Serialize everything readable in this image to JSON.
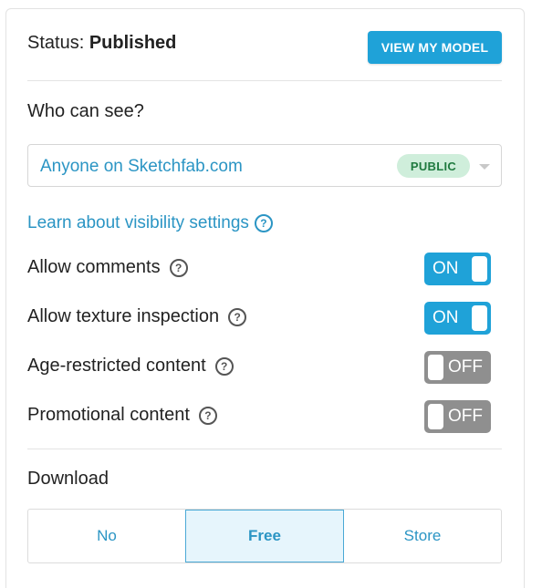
{
  "status": {
    "label": "Status:",
    "value": "Published"
  },
  "view_button": {
    "label": "VIEW MY MODEL"
  },
  "visibility": {
    "title": "Who can see?",
    "selected": "Anyone on Sketchfab.com",
    "badge": "PUBLIC",
    "learn_link": "Learn about visibility settings"
  },
  "options": [
    {
      "label": "Allow comments",
      "state": "ON",
      "enabled": true
    },
    {
      "label": "Allow texture inspection",
      "state": "ON",
      "enabled": true
    },
    {
      "label": "Age-restricted content",
      "state": "OFF",
      "enabled": false
    },
    {
      "label": "Promotional content",
      "state": "OFF",
      "enabled": false
    }
  ],
  "download": {
    "title": "Download",
    "choices": [
      "No",
      "Free",
      "Store"
    ],
    "selected": "Free"
  },
  "colors": {
    "accent": "#1fa2d8",
    "link": "#2b95c4",
    "toggle_off": "#8f8f8f",
    "badge_bg": "#cfeedb"
  }
}
